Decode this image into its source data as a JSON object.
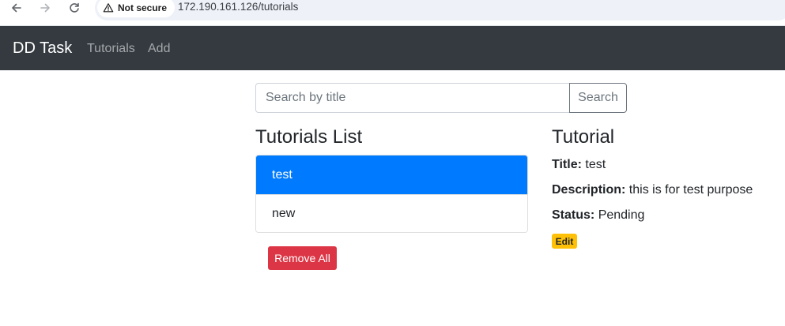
{
  "browser": {
    "back_icon": "arrow-left-icon",
    "forward_icon": "arrow-right-icon",
    "reload_icon": "reload-icon",
    "security_icon": "warning-triangle-icon",
    "security_label": "Not secure",
    "url": "172.190.161.126/tutorials"
  },
  "navbar": {
    "brand": "DD Task",
    "links": [
      {
        "label": "Tutorials"
      },
      {
        "label": "Add"
      }
    ],
    "background": "#343a40"
  },
  "search": {
    "placeholder": "Search by title",
    "value": "",
    "button_label": "Search"
  },
  "tutorials_list": {
    "title": "Tutorials List",
    "items": [
      {
        "label": "test",
        "selected": true
      },
      {
        "label": "new",
        "selected": false
      }
    ],
    "remove_all_label": "Remove All",
    "accent": "#007bff",
    "danger": "#dc3545"
  },
  "tutorial_detail": {
    "title": "Tutorial",
    "fields": [
      {
        "label": "Title:",
        "value": "test"
      },
      {
        "label": "Description:",
        "value": "this is for test purpose"
      },
      {
        "label": "Status:",
        "value": "Pending"
      }
    ],
    "edit_label": "Edit",
    "edit_color": "#ffc107"
  }
}
